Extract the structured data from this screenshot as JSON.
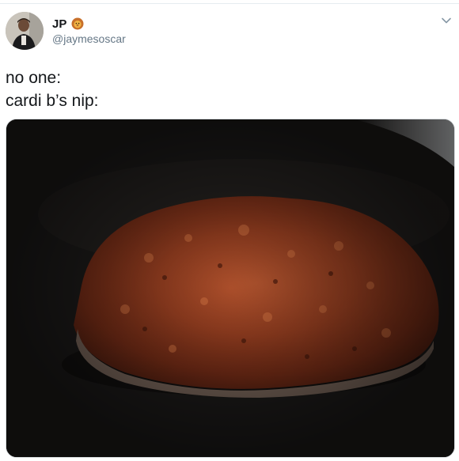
{
  "tweet": {
    "author": {
      "display_name": "JP",
      "handle": "@jaymesoscar",
      "avatar_icon": "profile-photo",
      "badge_icon": "lion-emoji-icon"
    },
    "menu_icon": "chevron-down-icon",
    "text_lines": [
      "no one:",
      "cardi b’s nip:"
    ],
    "media": {
      "kind": "photo",
      "subject": "burger-patty-on-pan"
    }
  },
  "colors": {
    "text_primary": "#14171a",
    "text_secondary": "#657786",
    "divider": "#e6ecf0"
  }
}
